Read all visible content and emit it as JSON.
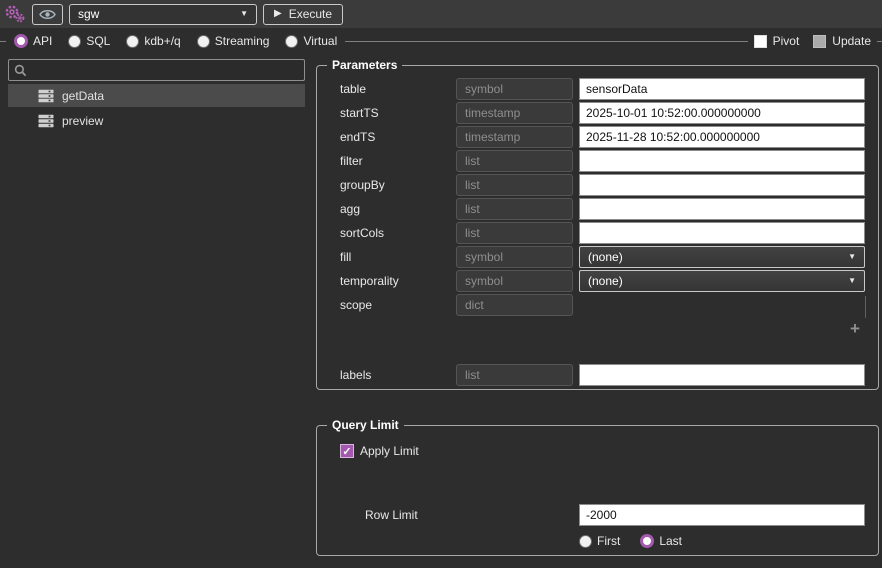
{
  "toolbar": {
    "connection_value": "sgw",
    "execute_label": "Execute"
  },
  "modes": {
    "options": [
      {
        "label": "API",
        "selected": true
      },
      {
        "label": "SQL",
        "selected": false
      },
      {
        "label": "kdb+/q",
        "selected": false
      },
      {
        "label": "Streaming",
        "selected": false
      },
      {
        "label": "Virtual",
        "selected": false
      }
    ],
    "pivot": {
      "label": "Pivot",
      "checked": false
    },
    "update": {
      "label": "Update",
      "checked": false,
      "disabled": true
    }
  },
  "sidebar": {
    "search_value": "",
    "items": [
      {
        "label": "getData",
        "selected": true
      },
      {
        "label": "preview",
        "selected": false
      }
    ]
  },
  "parameters": {
    "title": "Parameters",
    "rows": [
      {
        "name": "table",
        "type": "symbol",
        "value": "sensorData"
      },
      {
        "name": "startTS",
        "type": "timestamp",
        "value": "2025-10-01 10:52:00.000000000"
      },
      {
        "name": "endTS",
        "type": "timestamp",
        "value": "2025-11-28 10:52:00.000000000"
      },
      {
        "name": "filter",
        "type": "list",
        "value": ""
      },
      {
        "name": "groupBy",
        "type": "list",
        "value": ""
      },
      {
        "name": "agg",
        "type": "list",
        "value": ""
      },
      {
        "name": "sortCols",
        "type": "list",
        "value": ""
      },
      {
        "name": "fill",
        "type": "symbol",
        "value": "(none)"
      },
      {
        "name": "temporality",
        "type": "symbol",
        "value": "(none)"
      },
      {
        "name": "scope",
        "type": "dict",
        "value": ""
      }
    ],
    "add_button_label": "+",
    "labels_row": {
      "name": "labels",
      "type": "list",
      "value": ""
    }
  },
  "query_limit": {
    "title": "Query Limit",
    "apply_label": "Apply Limit",
    "apply_checked": true,
    "row_limit_label": "Row Limit",
    "row_limit_value": "-2000",
    "order_options": [
      {
        "label": "First",
        "selected": false
      },
      {
        "label": "Last",
        "selected": true
      }
    ]
  },
  "colors": {
    "accent": "#a259ae",
    "toolbar_bg": "#3b3b3b",
    "page_bg": "#2d2d2d"
  }
}
